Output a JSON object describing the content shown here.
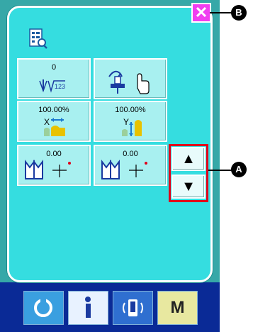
{
  "popup": {
    "close_label": "✕",
    "tiles": [
      {
        "value": "0",
        "icon": "stitch-count-icon",
        "label": "123"
      },
      {
        "value": "",
        "icon": "hand-operation-icon"
      },
      {
        "value": "100.00%",
        "icon": "x-scale-icon",
        "axis": "X"
      },
      {
        "value": "100.00%",
        "icon": "y-scale-icon",
        "axis": "Y"
      },
      {
        "value": "0.00",
        "icon": "x-move-icon"
      },
      {
        "value": "0.00",
        "icon": "y-move-icon"
      }
    ],
    "scroll_up": "▲",
    "scroll_down": "▼"
  },
  "bottom_bar": {
    "buttons": [
      "ready-icon",
      "info-icon",
      "communication-icon",
      "M"
    ]
  },
  "callouts": {
    "a": "A",
    "b": "B"
  },
  "colors": {
    "popup_bg": "#35dde0",
    "tile_bg": "#a8f0f0",
    "close_bg": "#f03ef0",
    "highlight": "#e0001a",
    "bottom_bar": "#0a2a96"
  }
}
